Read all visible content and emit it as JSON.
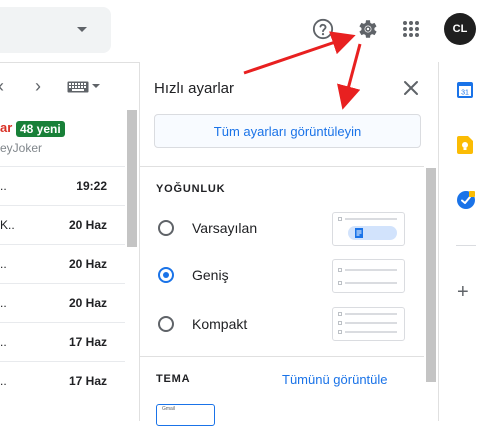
{
  "header": {
    "avatar_text": "CL",
    "icons": [
      "help-icon",
      "gear-icon",
      "apps-icon"
    ]
  },
  "inbox": {
    "category_tail": "ar",
    "new_badge": "48 yeni",
    "sender_sub": "eyJoker",
    "rows": [
      {
        "snippet": "..",
        "date": "19:22"
      },
      {
        "snippet": "K..",
        "date": "20 Haz"
      },
      {
        "snippet": "..",
        "date": "20 Haz"
      },
      {
        "snippet": "..",
        "date": "20 Haz"
      },
      {
        "snippet": "..",
        "date": "17 Haz"
      },
      {
        "snippet": "..",
        "date": "17 Haz"
      }
    ]
  },
  "quick_settings": {
    "title": "Hızlı ayarlar",
    "all_settings_button": "Tüm ayarları görüntüleyin",
    "density": {
      "heading": "YOĞUNLUK",
      "options": [
        {
          "label": "Varsayılan",
          "selected": false
        },
        {
          "label": "Geniş",
          "selected": true
        },
        {
          "label": "Kompakt",
          "selected": false
        }
      ]
    },
    "theme": {
      "heading": "TEMA",
      "view_all_link": "Tümünü görüntüle",
      "thumb_text": "Gmail"
    }
  },
  "side_panel": {
    "icons": [
      "calendar-icon",
      "keep-icon",
      "tasks-icon",
      "plus-icon"
    ]
  },
  "colors": {
    "accent": "#1a73e8",
    "badge_green": "#188038",
    "annotation_red": "#e82020"
  }
}
